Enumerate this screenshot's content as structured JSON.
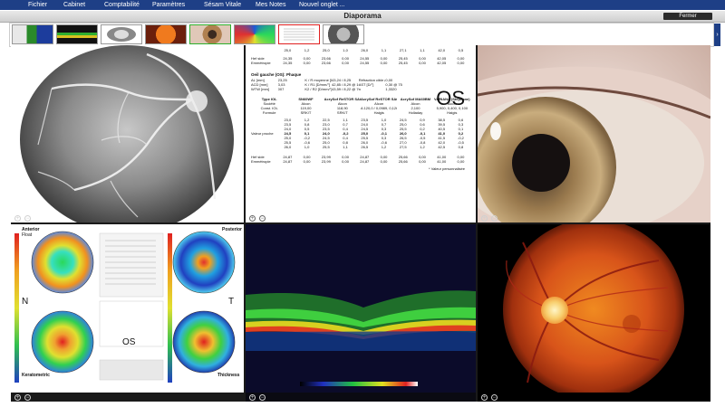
{
  "menu": [
    "Fichier",
    "Cabinet",
    "Comptabilité",
    "Paramètres",
    "Sésam Vitale",
    "Mes Notes",
    "Nouvel onglet ..."
  ],
  "window": {
    "title": "Diaporama",
    "close_label": "Fermer"
  },
  "thumbnails": [
    {
      "name": "thumb-topography",
      "selected": false
    },
    {
      "name": "thumb-oct-scan",
      "selected": false
    },
    {
      "name": "thumb-retinal-map",
      "selected": false
    },
    {
      "name": "thumb-fundus-photo",
      "selected": false
    },
    {
      "name": "thumb-eye-photo",
      "selected": false
    },
    {
      "name": "thumb-colormap",
      "selected": false
    },
    {
      "name": "thumb-document",
      "selected": true
    },
    {
      "name": "thumb-angiography",
      "selected": false
    }
  ],
  "biometry": {
    "header_row": [
      "25,0",
      "1,2",
      "25,0",
      "1,0",
      "26,0",
      "1,1",
      "27,1",
      "1,1",
      "42,0",
      "0,5"
    ],
    "summary_rows": [
      {
        "label": "Hef side",
        "values": [
          "24,35",
          "0,00",
          "23,66",
          "0,00",
          "24,55",
          "0,00",
          "25,45",
          "0,00",
          "42,05",
          "0,00"
        ]
      },
      {
        "label": "Emmétropie",
        "values": [
          "24,35",
          "0,00",
          "23,66",
          "0,00",
          "24,55",
          "0,00",
          "25,45",
          "0,00",
          "42,05",
          "0,00"
        ]
      }
    ],
    "section_title": "Oeil gauche (OS): Phaque",
    "eye_label": "OS",
    "params": [
      [
        "AL [mm]",
        "23,25",
        "K / R moyenne [D/mm]",
        "43,24 / 8,25",
        "Réfraction cible (D)",
        "0,00"
      ],
      [
        "ACD [mm]",
        "3,03",
        "K / R1 [D/mm/°]",
        "42,85 / 8,29 @ 160",
        "AST [D/°]",
        "0,30 @ 75"
      ],
      [
        "WTW [mm]",
        "007",
        "K2 / R2 [D/mm/°]",
        "43,59 / 8,22 @ 70",
        "n",
        "1,3320"
      ]
    ],
    "iol_header": [
      "Type IOL",
      "SN60WF",
      "AcrySof ReSTOR SA60D3",
      "AcrySof ReSTOR SA60AT",
      "AcrySof MA60BM",
      "VARIANA (Stephane)"
    ],
    "iol_rows": [
      [
        "Société",
        "Alcon",
        "Alcon",
        "Alcon",
        "Alcon",
        "Alcon"
      ],
      [
        "Const. IOL",
        "119,00",
        "118,90",
        "A 120,0 / 0,0989, 0,126",
        "2,100",
        "5,900, 0,400, 0,100"
      ],
      [
        "Formule",
        "SRK/T",
        "SRK/T",
        "Haigis",
        "Holladay",
        "Haigis"
      ]
    ],
    "power_rows": [
      [
        "23,0",
        "1,2",
        "22,5",
        "1,1",
        "23,5",
        "1,0",
        "24,5",
        "0,9",
        "38,5",
        "0,6"
      ],
      [
        "23,5",
        "0,8",
        "23,0",
        "0,7",
        "24,0",
        "0,7",
        "25,0",
        "0,6",
        "39,5",
        "0,3"
      ],
      [
        "24,0",
        "0,5",
        "23,5",
        "0,4",
        "24,5",
        "0,3",
        "25,5",
        "0,2",
        "40,5",
        "0,1"
      ],
      [
        "24,5",
        "0,1",
        "24,0",
        "-0,2",
        "25,0",
        "-0,1",
        "26,0",
        "-0,1",
        "41,0",
        "0,2"
      ],
      [
        "25,0",
        "-0,2",
        "24,5",
        "0,4",
        "25,5",
        "0,3",
        "26,5",
        "-0,5",
        "41,5",
        "-0,2"
      ],
      [
        "25,5",
        "-0,6",
        "25,0",
        "0,8",
        "26,0",
        "-0,6",
        "27,0",
        "-0,8",
        "42,0",
        "-0,5"
      ],
      [
        "26,0",
        "1,0",
        "25,5",
        "1,1",
        "26,5",
        "1,2",
        "27,5",
        "1,2",
        "42,5",
        "0,8"
      ]
    ],
    "value_label": "Valeur proche",
    "footer_rows": [
      {
        "label": "Hef side",
        "values": [
          "24,87",
          "0,00",
          "23,99",
          "0,00",
          "24,87",
          "0,00",
          "25,66",
          "0,00",
          "41,00",
          "0,00"
        ]
      },
      {
        "label": "Emmétropie",
        "values": [
          "24,87",
          "0,00",
          "23,99",
          "0,00",
          "24,87",
          "0,00",
          "25,66",
          "0,00",
          "41,00",
          "0,00"
        ]
      }
    ],
    "footnote": "* Valeur personnalisée"
  },
  "topography": {
    "labels": {
      "anterior": "Anterior",
      "float": "Float",
      "posterior": "Posterior",
      "n": "N",
      "t": "T",
      "os": "OS",
      "keratometric": "Keratometric",
      "thickness": "Thickness"
    }
  },
  "colors": {
    "menu_bg": "#1e3f86",
    "grid_bg": "#1a1a1a",
    "selected": "#e02020"
  }
}
